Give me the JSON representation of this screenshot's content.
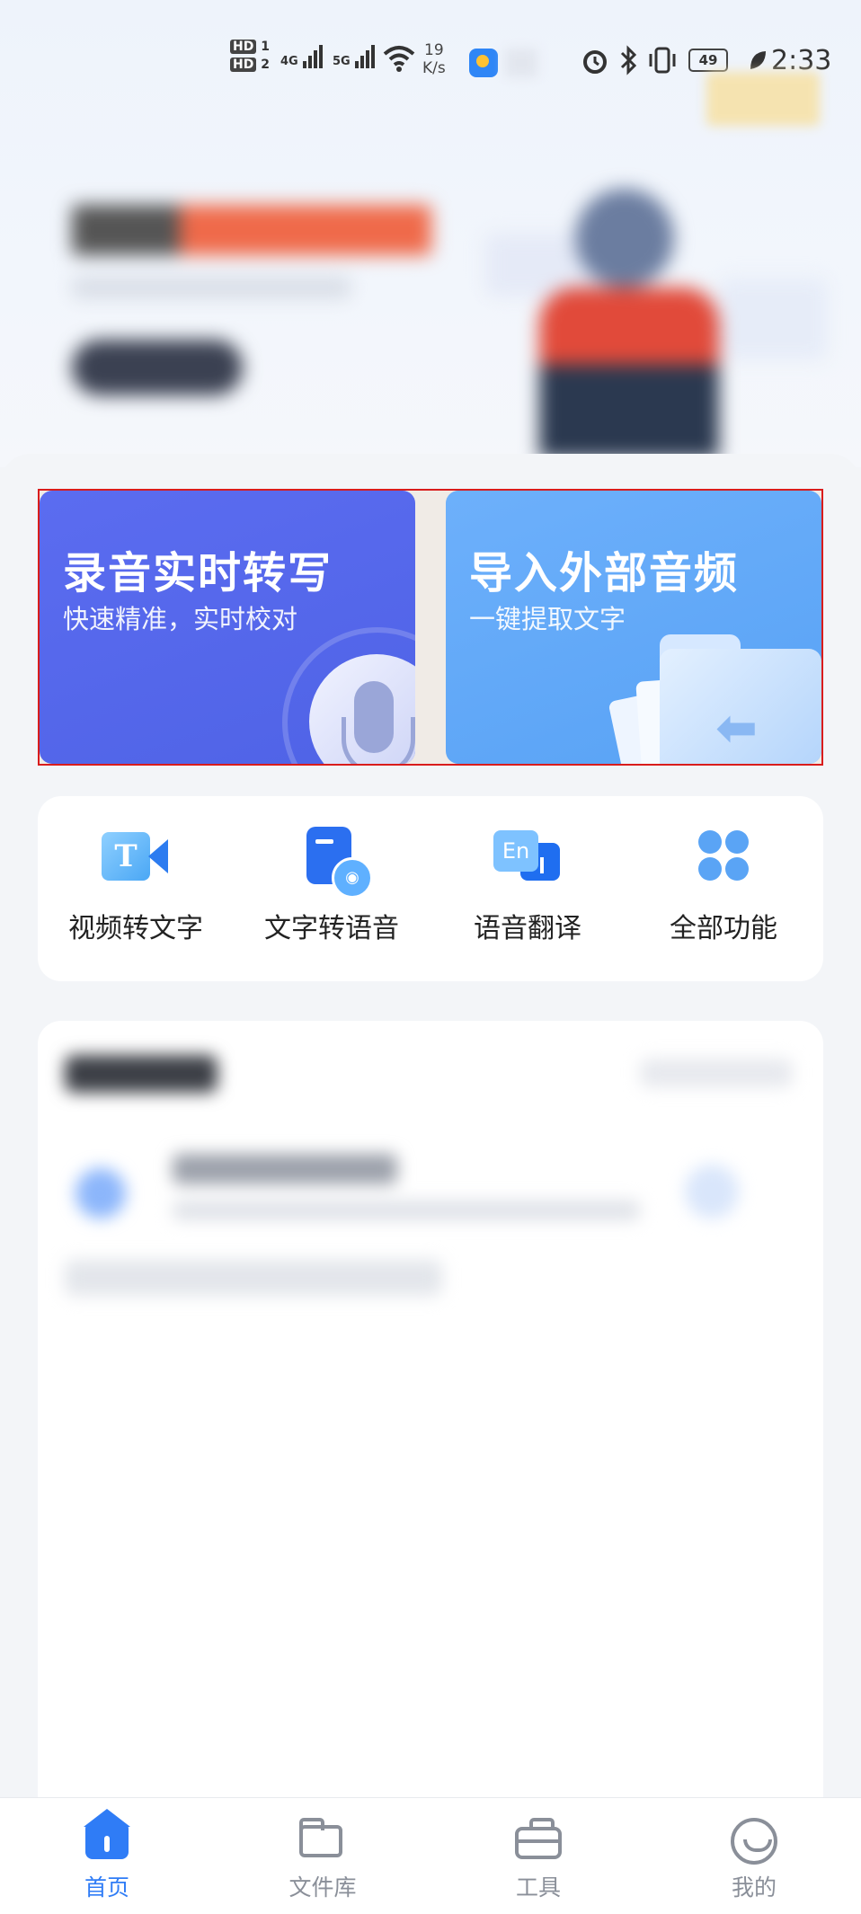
{
  "status_bar": {
    "sim1": "HD",
    "sim1_num": "1",
    "sim2": "HD",
    "sim2_num": "2",
    "net1": "4G",
    "net2": "5G",
    "speed_value": "19",
    "speed_unit": "K/s",
    "battery": "49",
    "time": "2:33",
    "icons": [
      "alarm-icon",
      "bluetooth-icon",
      "vibrate-icon",
      "battery-icon",
      "eco-leaf-icon",
      "wifi-icon",
      "weather-app-icon"
    ]
  },
  "cards": {
    "record": {
      "title": "录音实时转写",
      "subtitle": "快速精准，实时校对",
      "color": "#5166e8"
    },
    "import": {
      "title": "导入外部音频",
      "subtitle": "一键提取文字",
      "color": "#62a9f8"
    }
  },
  "tools": [
    {
      "label": "视频转文字",
      "icon": "video-to-text-icon"
    },
    {
      "label": "文字转语音",
      "icon": "text-to-speech-icon"
    },
    {
      "label": "语音翻译",
      "icon": "speech-translate-icon"
    },
    {
      "label": "全部功能",
      "icon": "all-functions-icon"
    }
  ],
  "tool_icon_glyphs": {
    "video": "T",
    "translate": "En",
    "tts": "◉"
  },
  "tabbar": {
    "items": [
      {
        "label": "首页",
        "icon": "home-icon",
        "active": true
      },
      {
        "label": "文件库",
        "icon": "folder-icon",
        "active": false
      },
      {
        "label": "工具",
        "icon": "toolbox-icon",
        "active": false
      },
      {
        "label": "我的",
        "icon": "profile-icon",
        "active": false
      }
    ],
    "active_color": "#2f7cf6",
    "inactive_color": "#8a8f99"
  }
}
